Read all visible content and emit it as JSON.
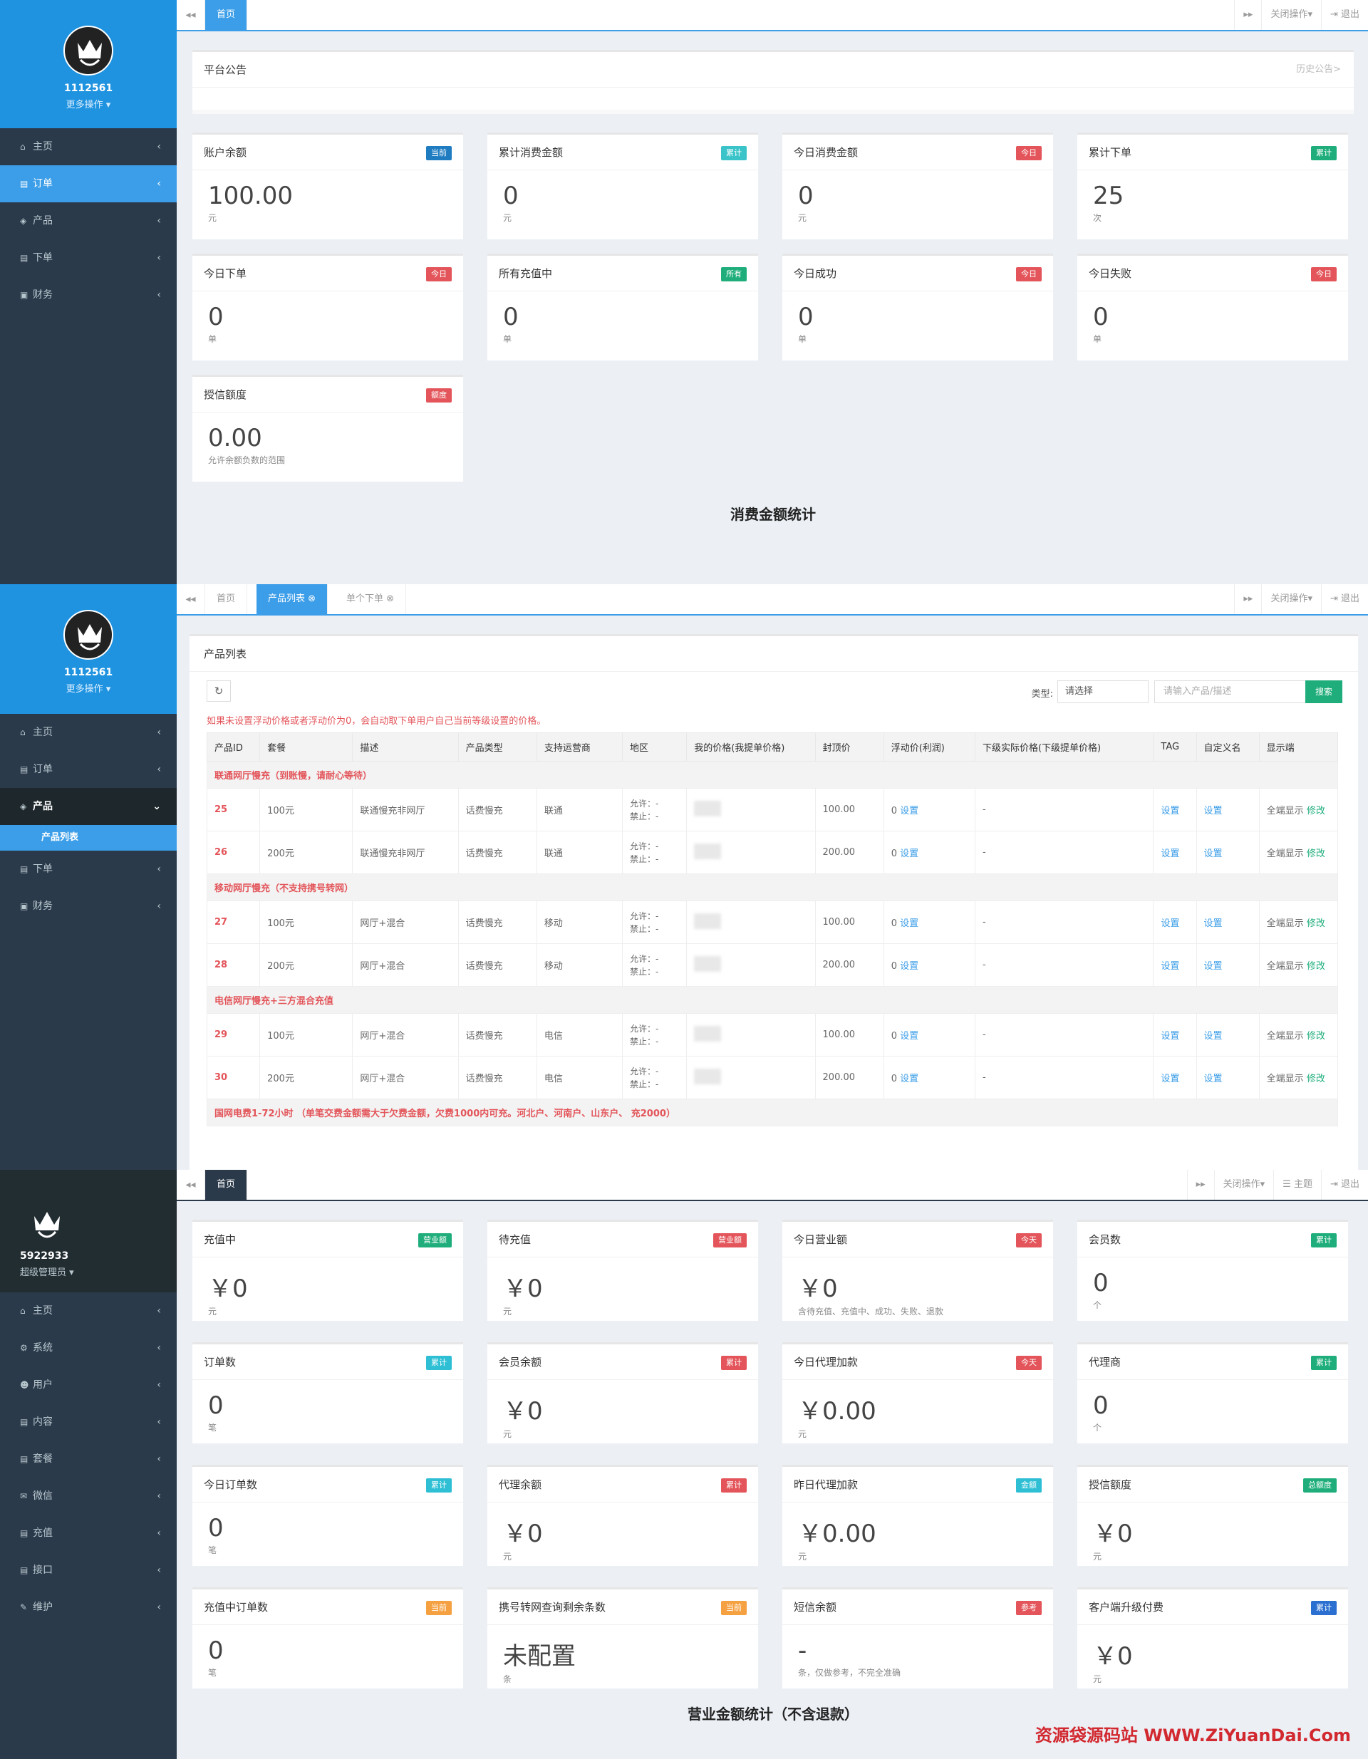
{
  "p1": {
    "user": {
      "name": "1112561",
      "more": "更多操作 ▾"
    },
    "menu": [
      {
        "icon": "home-icon",
        "glyph": "⌂",
        "label": "主页"
      },
      {
        "icon": "order-icon",
        "glyph": "▤",
        "label": "订单",
        "active": true
      },
      {
        "icon": "cube-icon",
        "glyph": "◈",
        "label": "产品"
      },
      {
        "icon": "file-icon",
        "glyph": "▤",
        "label": "下单"
      },
      {
        "icon": "money-icon",
        "glyph": "▣",
        "label": "财务"
      }
    ],
    "tabs": [
      "首页"
    ],
    "top_right": [
      "关闭操作▾",
      "⇥ 退出"
    ],
    "notice": {
      "title": "平台公告",
      "more": "历史公告>"
    },
    "cards": [
      {
        "title": "账户余额",
        "badge": "当前",
        "color": "blue",
        "value": "100.00",
        "unit": "元"
      },
      {
        "title": "累计消费金额",
        "badge": "累计",
        "color": "teal",
        "value": "0",
        "unit": "元"
      },
      {
        "title": "今日消费金额",
        "badge": "今日",
        "color": "red",
        "value": "0",
        "unit": "元"
      },
      {
        "title": "累计下单",
        "badge": "累计",
        "color": "green",
        "value": "25",
        "unit": "次"
      },
      {
        "title": "今日下单",
        "badge": "今日",
        "color": "red",
        "value": "0",
        "unit": "单"
      },
      {
        "title": "所有充值中",
        "badge": "所有",
        "color": "green",
        "value": "0",
        "unit": "单"
      },
      {
        "title": "今日成功",
        "badge": "今日",
        "color": "red",
        "value": "0",
        "unit": "单"
      },
      {
        "title": "今日失败",
        "badge": "今日",
        "color": "red",
        "value": "0",
        "unit": "单"
      },
      {
        "title": "授信额度",
        "badge": "额度",
        "color": "red",
        "value": "0.00",
        "unit": "允许余额负数的范围"
      }
    ],
    "section_title": "消费金额统计"
  },
  "p2": {
    "user": {
      "name": "1112561",
      "more": "更多操作 ▾"
    },
    "menu": [
      {
        "icon": "home-icon",
        "glyph": "⌂",
        "label": "主页"
      },
      {
        "icon": "order-icon",
        "glyph": "▤",
        "label": "订单"
      },
      {
        "icon": "cube-icon",
        "glyph": "◈",
        "label": "产品",
        "open": true
      },
      {
        "icon": "file-icon",
        "glyph": "▤",
        "label": "下单"
      },
      {
        "icon": "money-icon",
        "glyph": "▣",
        "label": "财务"
      }
    ],
    "submenu": "产品列表",
    "tabs": [
      "首页",
      "产品列表 ⊗",
      "单个下单 ⊗"
    ],
    "top_right": [
      "关闭操作▾",
      "⇥ 退出"
    ],
    "panel_title": "产品列表",
    "filter": {
      "label": "类型:",
      "select": "请选择",
      "placeholder": "请输入产品/描述",
      "button": "搜索"
    },
    "warning": "如果未设置浮动价格或者浮动价为0，会自动取下单用户自己当前等级设置的价格。",
    "columns": [
      "产品ID",
      "套餐",
      "描述",
      "产品类型",
      "支持运营商",
      "地区",
      "我的价格(我提单价格)",
      "封顶价",
      "浮动价(利润)",
      "下级实际价格(下级提单价格)",
      "TAG",
      "自定义名",
      "显示端"
    ],
    "groups": [
      {
        "name": "联通网厅慢充（到账慢，请耐心等待）",
        "rows": [
          {
            "id": "25",
            "pkg": "100元",
            "desc": "联通慢充非网厅",
            "type": "话费慢充",
            "op": "联通",
            "cap": "100.00"
          },
          {
            "id": "26",
            "pkg": "200元",
            "desc": "联通慢充非网厅",
            "type": "话费慢充",
            "op": "联通",
            "cap": "200.00"
          }
        ]
      },
      {
        "name": "移动网厅慢充（不支持携号转网）",
        "rows": [
          {
            "id": "27",
            "pkg": "100元",
            "desc": "网厅+混合",
            "type": "话费慢充",
            "op": "移动",
            "cap": "100.00"
          },
          {
            "id": "28",
            "pkg": "200元",
            "desc": "网厅+混合",
            "type": "话费慢充",
            "op": "移动",
            "cap": "200.00"
          }
        ]
      },
      {
        "name": "电信网厅慢充+三方混合充值",
        "rows": [
          {
            "id": "29",
            "pkg": "100元",
            "desc": "网厅+混合",
            "type": "话费慢充",
            "op": "电信",
            "cap": "100.00"
          },
          {
            "id": "30",
            "pkg": "200元",
            "desc": "网厅+混合",
            "type": "话费慢充",
            "op": "电信",
            "cap": "200.00"
          }
        ]
      },
      {
        "name": "国网电费1-72小时 （单笔交费金额需大于欠费金额，欠费1000内可充。河北户、河南户、山东户、  充2000）",
        "rows": []
      }
    ],
    "row_text": {
      "allow": "允许：-",
      "forbid": "禁止：-",
      "float": "0",
      "set": "设置",
      "dash": "-",
      "display": "全端显示",
      "edit": "修改"
    }
  },
  "p3": {
    "user": {
      "name": "5922933",
      "more": "超级管理员 ▾"
    },
    "menu": [
      {
        "icon": "home-icon",
        "glyph": "⌂",
        "label": "主页"
      },
      {
        "icon": "gears-icon",
        "glyph": "⚙",
        "label": "系统"
      },
      {
        "icon": "users-icon",
        "glyph": "☻",
        "label": "用户"
      },
      {
        "icon": "file-icon",
        "glyph": "▤",
        "label": "内容"
      },
      {
        "icon": "file-icon",
        "glyph": "▤",
        "label": "套餐"
      },
      {
        "icon": "wechat-icon",
        "glyph": "✉",
        "label": "微信"
      },
      {
        "icon": "file-icon",
        "glyph": "▤",
        "label": "充值"
      },
      {
        "icon": "file-icon",
        "glyph": "▤",
        "label": "接口"
      },
      {
        "icon": "wrench-icon",
        "glyph": "✎",
        "label": "维护"
      }
    ],
    "tabs": [
      "首页"
    ],
    "top_right": [
      "关闭操作▾",
      "☰ 主题",
      "⇥ 退出"
    ],
    "cards": [
      {
        "title": "充值中",
        "badge": "营业额",
        "color": "green",
        "value": "￥0",
        "unit": "元"
      },
      {
        "title": "待充值",
        "badge": "营业额",
        "color": "red",
        "value": "￥0",
        "unit": "元"
      },
      {
        "title": "今日营业额",
        "badge": "今天",
        "color": "red",
        "value": "￥0",
        "unit": "含待充值、充值中、成功、失败、退款"
      },
      {
        "title": "会员数",
        "badge": "累计",
        "color": "green",
        "value": "0",
        "unit": "个"
      },
      {
        "title": "订单数",
        "badge": "累计",
        "color": "cyan",
        "value": "0",
        "unit": "笔"
      },
      {
        "title": "会员余额",
        "badge": "累计",
        "color": "red",
        "value": "￥0",
        "unit": "元"
      },
      {
        "title": "今日代理加款",
        "badge": "今天",
        "color": "red",
        "value": "￥0.00",
        "unit": "元"
      },
      {
        "title": "代理商",
        "badge": "累计",
        "color": "green",
        "value": "0",
        "unit": "个"
      },
      {
        "title": "今日订单数",
        "badge": "累计",
        "color": "cyan",
        "value": "0",
        "unit": "笔"
      },
      {
        "title": "代理余额",
        "badge": "累计",
        "color": "red",
        "value": "￥0",
        "unit": "元"
      },
      {
        "title": "昨日代理加款",
        "badge": "金额",
        "color": "cyan",
        "value": "￥0.00",
        "unit": "元"
      },
      {
        "title": "授信额度",
        "badge": "总额度",
        "color": "green",
        "value": "￥0",
        "unit": "元"
      },
      {
        "title": "充值中订单数",
        "badge": "当前",
        "color": "orange",
        "value": "0",
        "unit": "笔"
      },
      {
        "title": "携号转网查询剩余条数",
        "badge": "当前",
        "color": "orange",
        "value": "未配置",
        "unit": "条"
      },
      {
        "title": "短信余额",
        "badge": "参考",
        "color": "red",
        "value": "-",
        "unit": "条，仅做参考，不完全准确"
      },
      {
        "title": "客户端升级付费",
        "badge": "累计",
        "color": "navy",
        "value": "￥0",
        "unit": "元"
      }
    ],
    "section_title": "营业金额统计（不含退款）",
    "watermark": "资源袋源码站 WWW.ZiYuanDai.Com"
  },
  "colors": {
    "primary": "#3c9ee8",
    "sidebar": "#2b3a4a",
    "danger": "#e3555a",
    "success": "#1fae7b"
  }
}
